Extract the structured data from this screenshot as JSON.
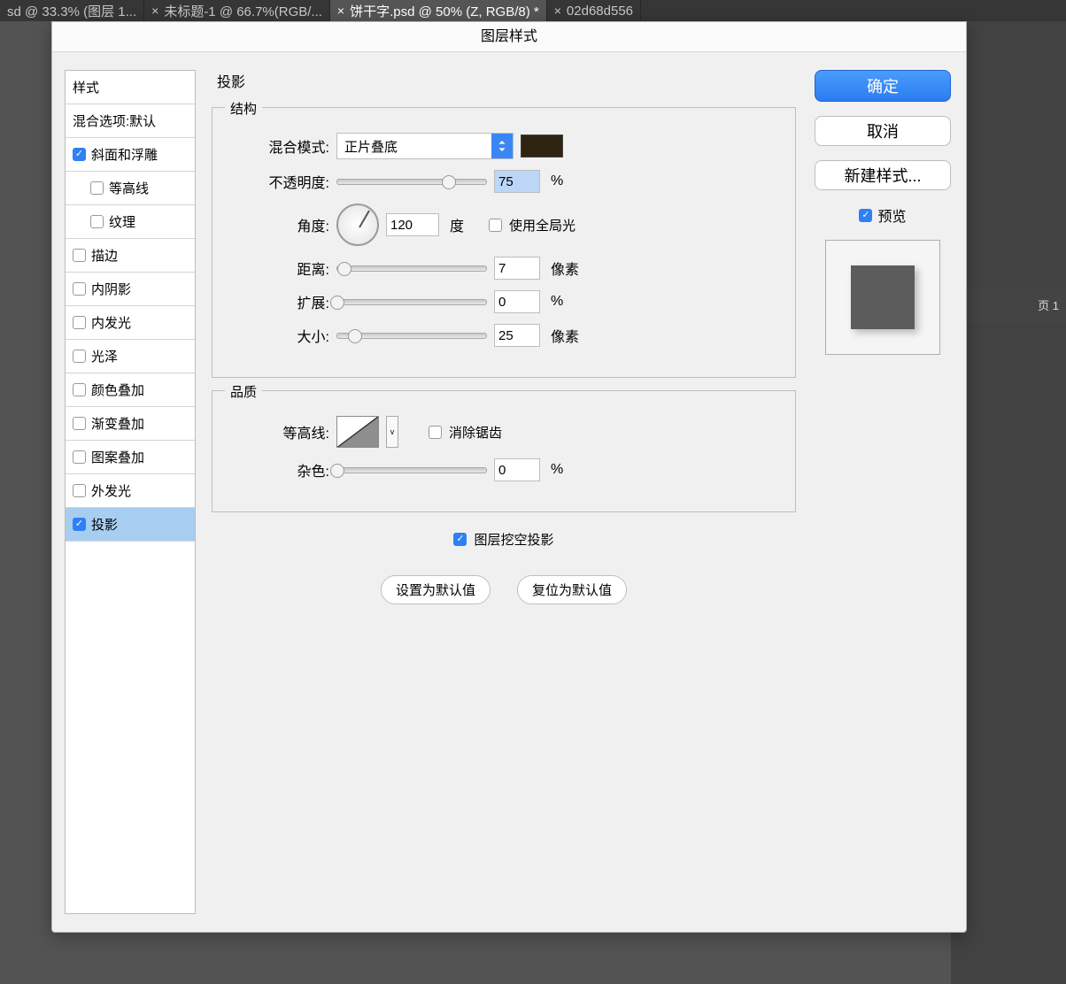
{
  "tabs": [
    {
      "label": "sd @ 33.3% (图层 1..."
    },
    {
      "label": "未标题-1 @ 66.7%(RGB/..."
    },
    {
      "label": "饼干字.psd @ 50% (Z, RGB/8) *",
      "active": true
    },
    {
      "label": "02d68d556"
    }
  ],
  "dialog_title": "图层样式",
  "styles_header": "样式",
  "blend_defaults": "混合选项:默认",
  "style_list": [
    {
      "label": "斜面和浮雕",
      "checked": true
    },
    {
      "label": "等高线",
      "checked": false,
      "sub": true
    },
    {
      "label": "纹理",
      "checked": false,
      "sub": true
    },
    {
      "label": "描边",
      "checked": false
    },
    {
      "label": "内阴影",
      "checked": false
    },
    {
      "label": "内发光",
      "checked": false
    },
    {
      "label": "光泽",
      "checked": false
    },
    {
      "label": "颜色叠加",
      "checked": false
    },
    {
      "label": "渐变叠加",
      "checked": false
    },
    {
      "label": "图案叠加",
      "checked": false
    },
    {
      "label": "外发光",
      "checked": false
    },
    {
      "label": "投影",
      "checked": true,
      "selected": true
    }
  ],
  "panel_title": "投影",
  "structure": {
    "legend": "结构",
    "blend_mode_label": "混合模式:",
    "blend_mode_value": "正片叠底",
    "swatch": "#2f2311",
    "opacity_label": "不透明度:",
    "opacity_value": "75",
    "opacity_unit": "%",
    "angle_label": "角度:",
    "angle_value": "120",
    "angle_unit": "度",
    "global_light_label": "使用全局光",
    "global_light_checked": false,
    "distance_label": "距离:",
    "distance_value": "7",
    "distance_unit": "像素",
    "spread_label": "扩展:",
    "spread_value": "0",
    "spread_unit": "%",
    "size_label": "大小:",
    "size_value": "25",
    "size_unit": "像素"
  },
  "quality": {
    "legend": "品质",
    "contour_label": "等高线:",
    "antialias_label": "消除锯齿",
    "antialias_checked": false,
    "noise_label": "杂色:",
    "noise_value": "0",
    "noise_unit": "%"
  },
  "knockout_label": "图层挖空投影",
  "knockout_checked": true,
  "set_default": "设置为默认值",
  "reset_default": "复位为默认值",
  "ok": "确定",
  "cancel": "取消",
  "new_style": "新建样式...",
  "preview_label": "预览",
  "preview_checked": true,
  "bg_panel_text": "页 1"
}
